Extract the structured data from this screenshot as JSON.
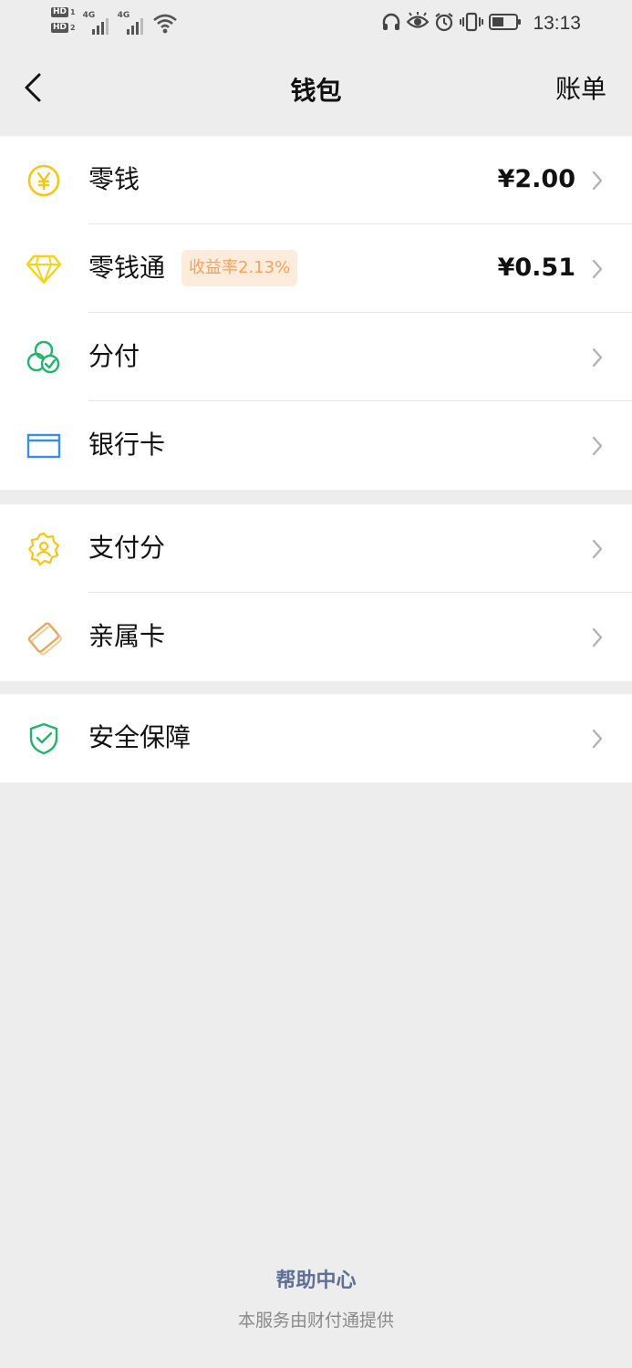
{
  "status_bar": {
    "hd1": "HD",
    "hd1_sub": "1",
    "hd2": "HD",
    "hd2_sub": "2",
    "net1": "4G",
    "net2": "4G",
    "time": "13:13",
    "icons": [
      "headphones-icon",
      "eye-icon",
      "alarm-icon",
      "vibrate-icon",
      "battery-icon"
    ]
  },
  "nav": {
    "title": "钱包",
    "action": "账单"
  },
  "groups": [
    {
      "items": [
        {
          "id": "lingqian",
          "icon": "yuan-coin-icon",
          "label": "零钱",
          "amount": "¥2.00"
        },
        {
          "id": "lingqiantong",
          "icon": "diamond-icon",
          "label": "零钱通",
          "badge": "收益率2.13%",
          "amount": "¥0.51"
        },
        {
          "id": "fenfu",
          "icon": "fenfu-icon",
          "label": "分付"
        },
        {
          "id": "bank-card",
          "icon": "bank-card-icon",
          "label": "银行卡"
        }
      ]
    },
    {
      "items": [
        {
          "id": "payment-score",
          "icon": "payment-score-icon",
          "label": "支付分"
        },
        {
          "id": "family-card",
          "icon": "family-card-icon",
          "label": "亲属卡"
        }
      ]
    },
    {
      "items": [
        {
          "id": "security",
          "icon": "shield-check-icon",
          "label": "安全保障"
        }
      ]
    }
  ],
  "footer": {
    "help_link": "帮助中心",
    "provider": "本服务由财付通提供"
  },
  "colors": {
    "background": "#ededed",
    "coin": "#f5c518",
    "diamond": "#f3d21c",
    "fenfu": "#23b36b",
    "bank": "#3a8ee6",
    "payment_score": "#f5c518",
    "family_card": "#e8a95c",
    "security": "#23b36b",
    "badge_bg": "#fdebdc",
    "badge_text": "#f0a45a",
    "help_link": "#5f6f95"
  }
}
